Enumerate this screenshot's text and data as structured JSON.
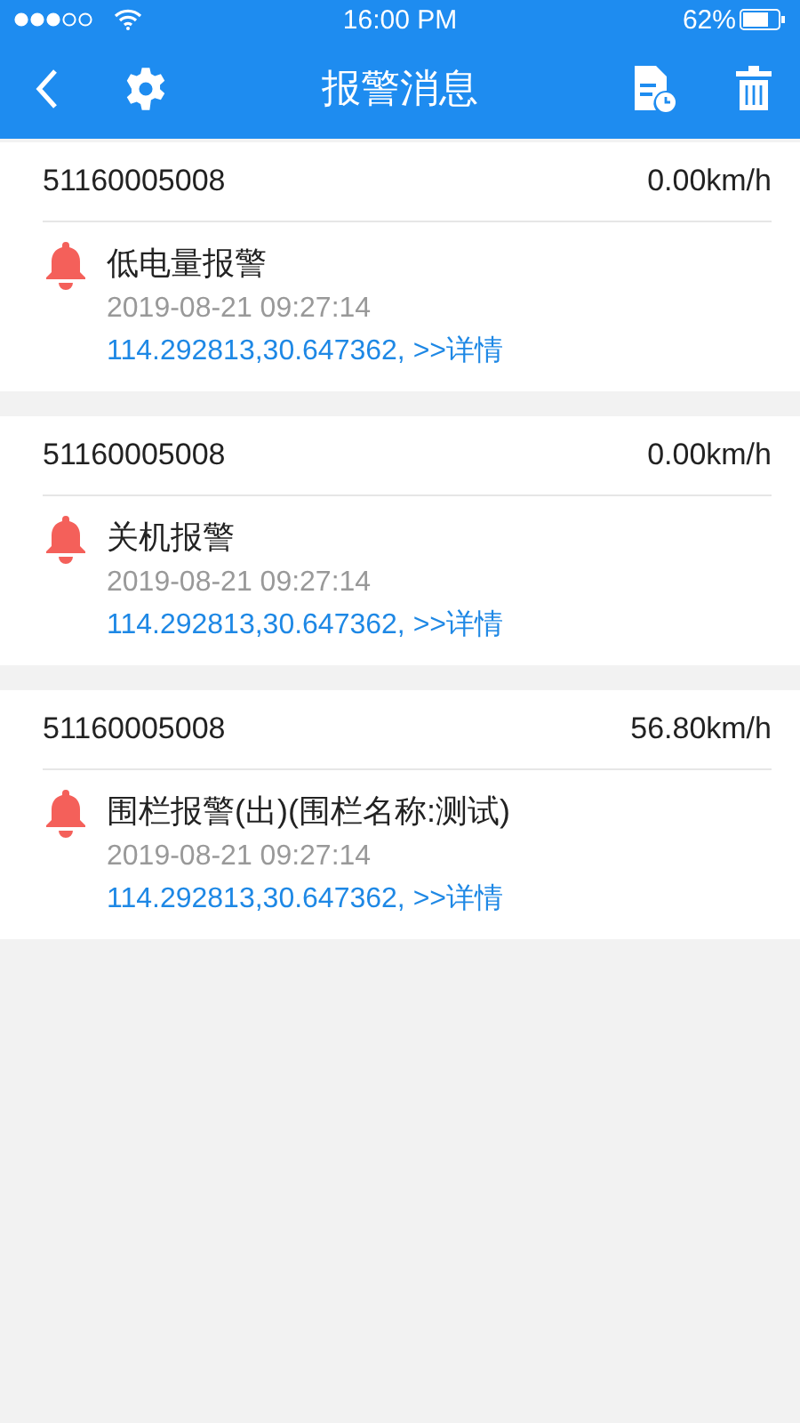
{
  "status_bar": {
    "time": "16:00  PM",
    "battery": "62%"
  },
  "nav_bar": {
    "title": "报警消息"
  },
  "alarms": [
    {
      "device": "51160005008",
      "speed": "0.00km/h",
      "type": "低电量报警",
      "time": "2019-08-21 09:27:14",
      "location": "114.292813,30.647362, >>详情"
    },
    {
      "device": "51160005008",
      "speed": "0.00km/h",
      "type": "关机报警",
      "time": "2019-08-21 09:27:14",
      "location": "114.292813,30.647362, >>详情"
    },
    {
      "device": "51160005008",
      "speed": "56.80km/h",
      "type": "围栏报警(出)(围栏名称:测试)",
      "time": "2019-08-21 09:27:14",
      "location": "114.292813,30.647362, >>详情"
    }
  ]
}
